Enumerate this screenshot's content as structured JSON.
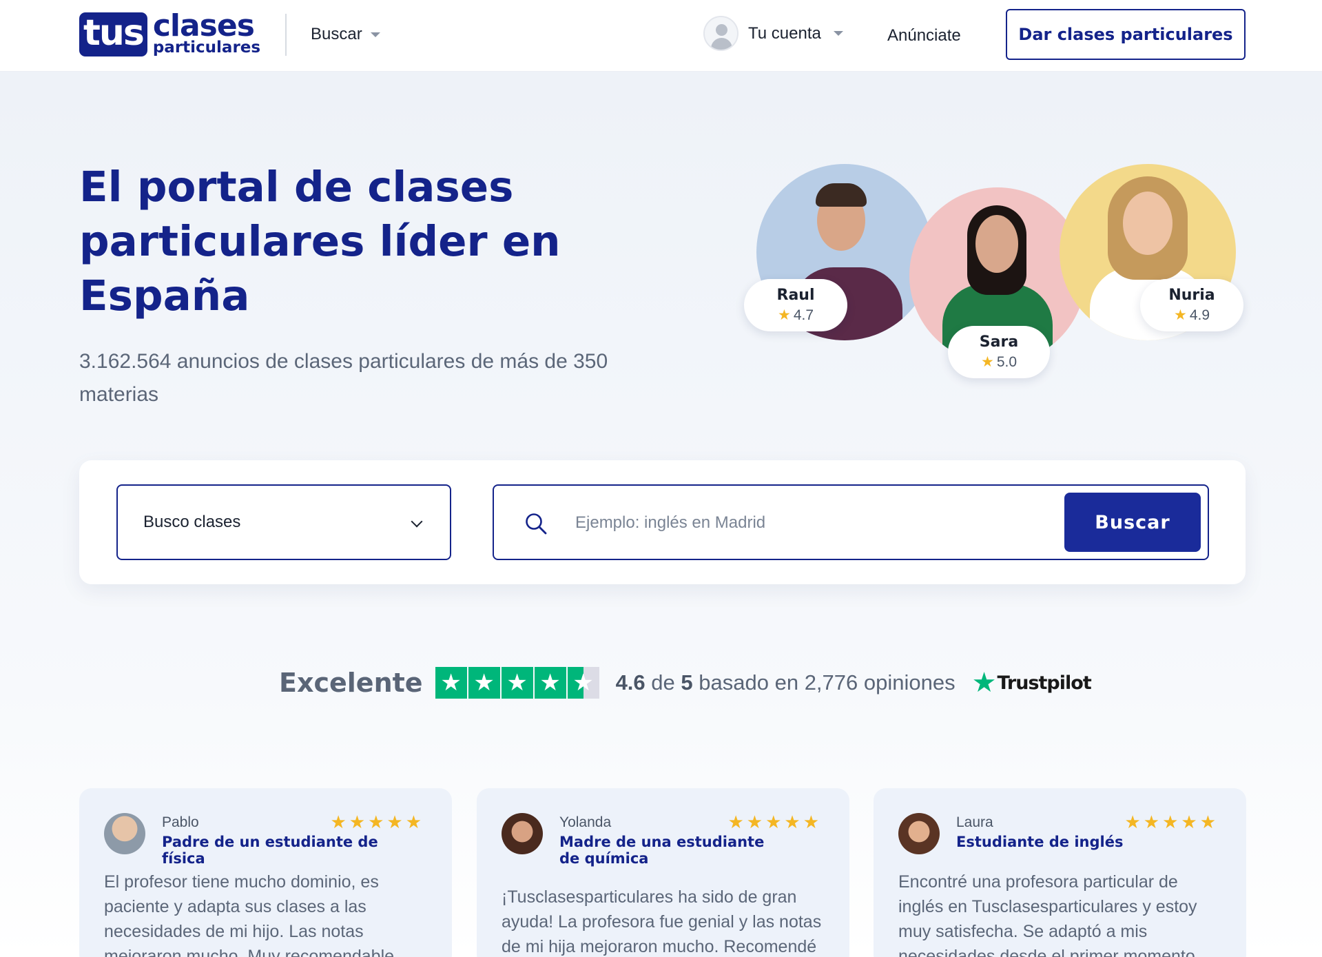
{
  "header": {
    "logo_box": "tus",
    "logo_line1": "clases",
    "logo_line2": "particulares",
    "nav_buscar": "Buscar",
    "account_label": "Tu cuenta",
    "anunciate": "Anúnciate",
    "cta": "Dar clases particulares"
  },
  "hero": {
    "title": "El portal de clases particulares líder en España",
    "subtitle": "3.162.564 anuncios de clases particulares de más de 350 materias",
    "tutors": [
      {
        "name": "Raul",
        "rating": "4.7"
      },
      {
        "name": "Sara",
        "rating": "5.0"
      },
      {
        "name": "Nuria",
        "rating": "4.9"
      }
    ]
  },
  "search": {
    "select_value": "Busco clases",
    "placeholder": "Ejemplo: inglés en Madrid",
    "button": "Buscar"
  },
  "trustpilot": {
    "label": "Excelente",
    "score": "4.6",
    "of": "de",
    "max": "5",
    "rest": "basado en 2,776 opiniones",
    "brand": "Trustpilot",
    "stars_value": 4.6
  },
  "reviews": [
    {
      "name": "Pablo",
      "role": "Padre de un estudiante de física",
      "stars": "★★★★★",
      "text": "El profesor tiene mucho dominio, es paciente y adapta sus clases a las necesidades de mi hijo. Las notas mejoraron mucho. Muy recomendable"
    },
    {
      "name": "Yolanda",
      "role": "Madre de una estudiante de química",
      "stars": "★★★★★",
      "text": "¡Tusclasesparticulares ha sido de gran ayuda! La profesora fue genial y las notas de mi hija mejoraron mucho. Recomendé"
    },
    {
      "name": "Laura",
      "role": "Estudiante de inglés",
      "stars": "★★★★★",
      "text": "Encontré una profesora particular de inglés en Tusclasesparticulares y estoy muy satisfecha. Se adaptó a mis necesidades desde el primer momento"
    }
  ],
  "colors": {
    "brand_navy": "#14238a",
    "button_blue": "#1a2b9a",
    "trustpilot_green": "#00b67a",
    "star_gold": "#f4b623"
  }
}
